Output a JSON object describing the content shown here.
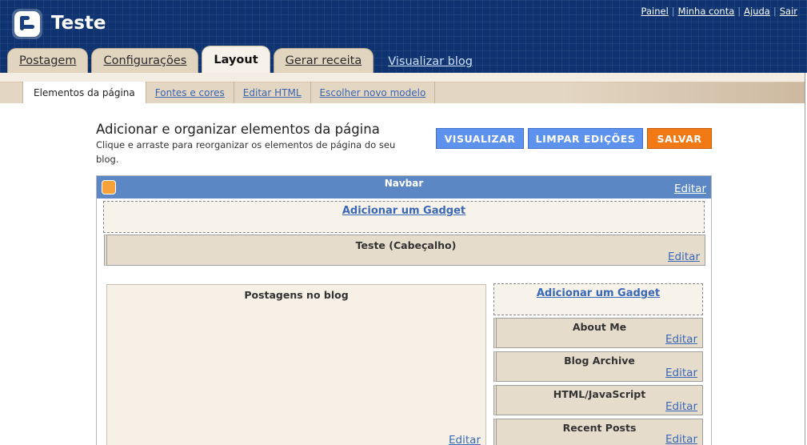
{
  "header": {
    "blog_title": "Teste",
    "links": [
      "Painel",
      "Minha conta",
      "Ajuda",
      "Sair"
    ],
    "link_separator": "|"
  },
  "tabs": {
    "items": [
      "Postagem",
      "Configurações",
      "Layout",
      "Gerar receita"
    ],
    "active": "Layout",
    "view_blog": "Visualizar blog"
  },
  "subtabs": {
    "items": [
      "Elementos da página",
      "Fontes e cores",
      "Editar HTML",
      "Escolher novo modelo"
    ],
    "active": "Elementos da página"
  },
  "content": {
    "heading": "Adicionar e organizar elementos da página",
    "description": "Clique e arraste para reorganizar os elementos de página do seu blog."
  },
  "buttons": {
    "preview": "VISUALIZAR",
    "clear": "LIMPAR EDIÇÕES",
    "save": "SALVAR"
  },
  "layout": {
    "navbar_title": "Navbar",
    "edit_label": "Editar",
    "add_gadget": "Adicionar um Gadget",
    "header_widget": "Teste (Cabeçalho)",
    "main_column": "Postagens no blog",
    "sidebar_widgets": [
      "About Me",
      "Blog Archive",
      "HTML/JavaScript",
      "Recent Posts"
    ]
  },
  "colors": {
    "header_bg": "#0e3370",
    "navbar_bg": "#5b88c4",
    "primary_button": "#5e92ef",
    "save_button": "#f17a14",
    "link": "#3a68b7"
  }
}
